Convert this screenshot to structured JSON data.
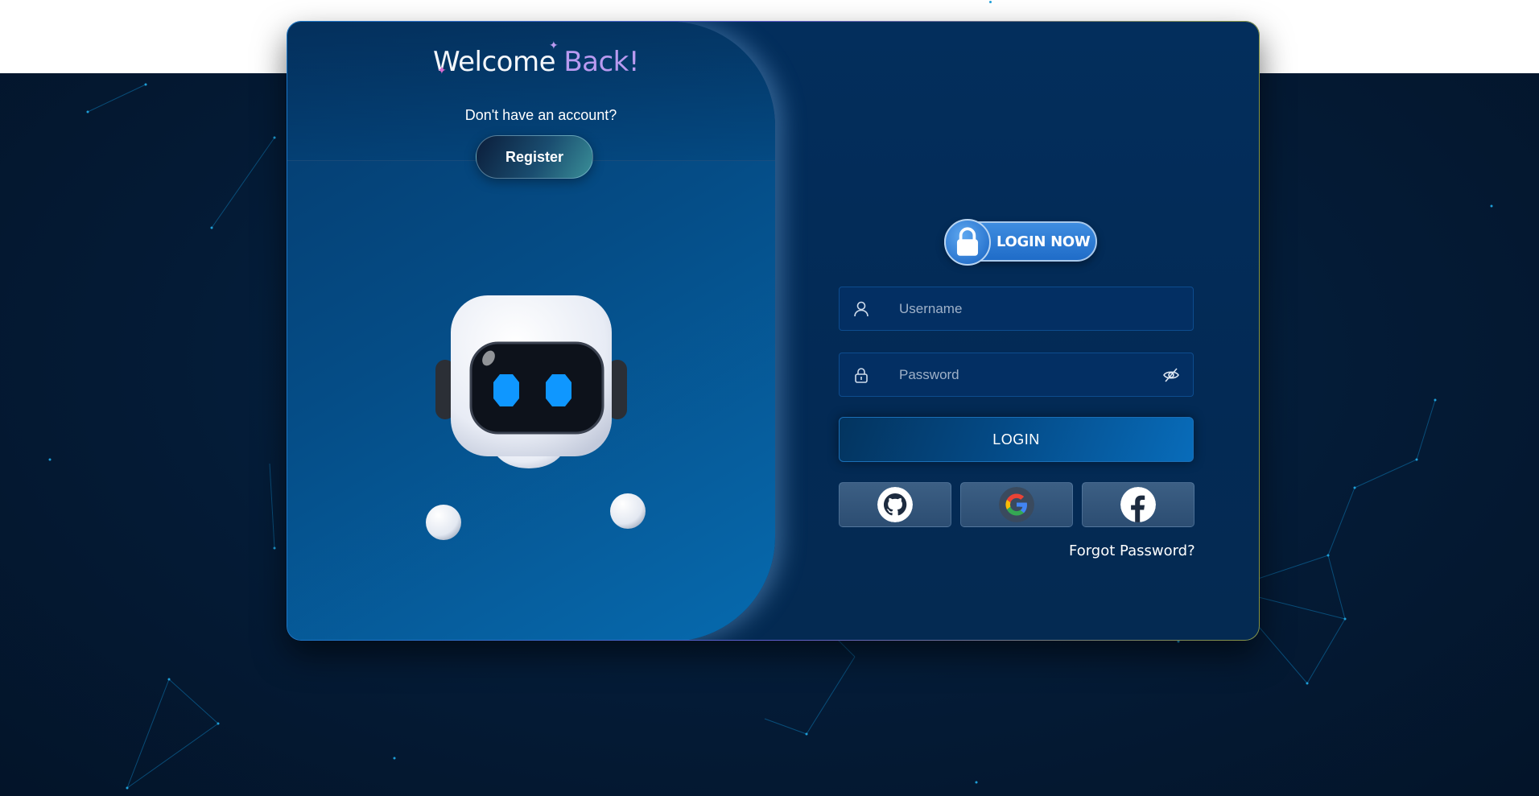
{
  "left_panel": {
    "welcome_part1": "Welcome",
    "welcome_part2": "Back!",
    "subtitle": "Don't have an account?",
    "register_label": "Register"
  },
  "right_panel": {
    "badge_label": "LOGIN NOW",
    "username_placeholder": "Username",
    "password_placeholder": "Password",
    "login_label": "LOGIN",
    "forgot_label": "Forgot Password?",
    "social": [
      {
        "icon": "github-icon"
      },
      {
        "icon": "google-icon"
      },
      {
        "icon": "facebook-icon"
      }
    ]
  },
  "colors": {
    "background": "#041b36",
    "accent": "#b99af0",
    "primary": "#1f6cc8",
    "robot_eye": "#0f97ff"
  }
}
